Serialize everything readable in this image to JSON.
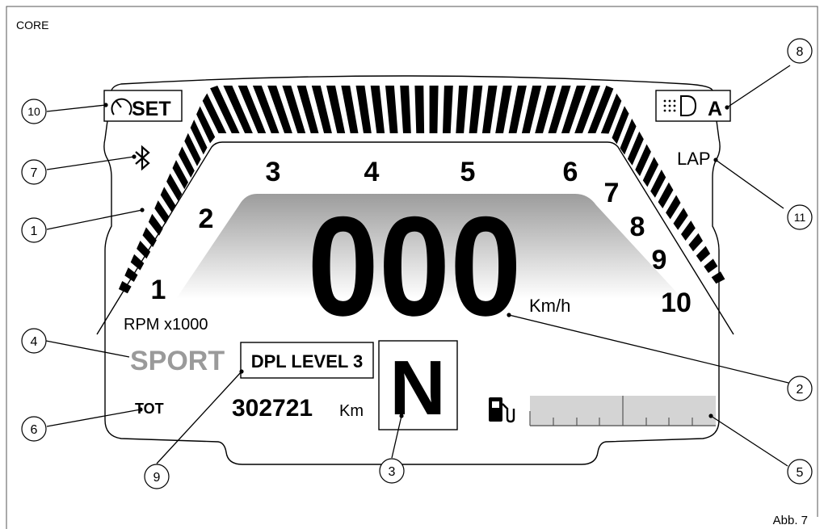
{
  "header": {
    "section": "CORE"
  },
  "footer": {
    "figure_ref": "Abb. 7"
  },
  "dash": {
    "rpm_scale": [
      "1",
      "2",
      "3",
      "4",
      "5",
      "6",
      "7",
      "8",
      "9",
      "10"
    ],
    "rpm_unit": "RPM x1000",
    "speed": "000",
    "speed_unit": "Km/h",
    "mode": "SPORT",
    "dpl": "DPL LEVEL 3",
    "gear": "N",
    "trip_label": "TOT",
    "odometer": "302721",
    "odometer_unit": "Km",
    "set_label": "SET",
    "headlight_mode": "A",
    "lap_label": "LAP"
  },
  "callouts": [
    "1",
    "2",
    "3",
    "4",
    "5",
    "6",
    "7",
    "8",
    "9",
    "10",
    "11"
  ],
  "colors": {
    "ink": "#000000",
    "mode_grey": "#9a9a9a",
    "fuel_bar": "#d4d4d4"
  }
}
